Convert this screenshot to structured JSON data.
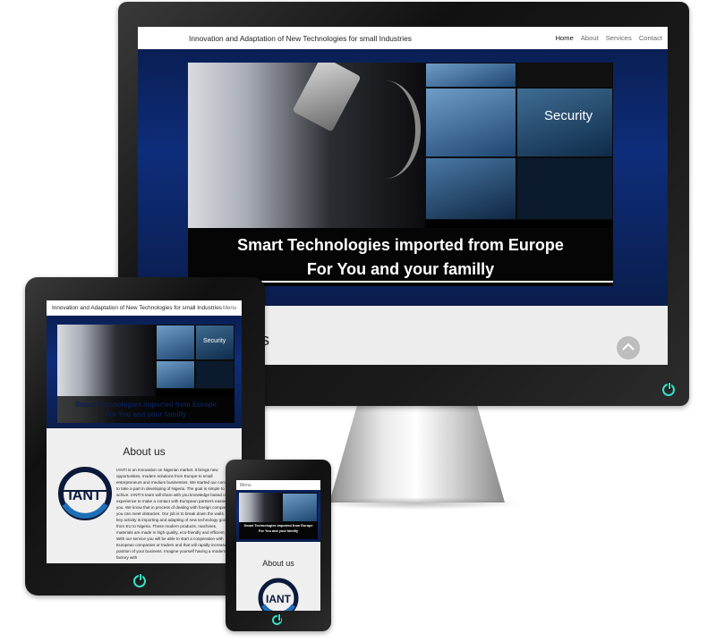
{
  "site": {
    "title": "Innovation and Adaptation of New Technologies for small Industries",
    "nav": [
      "Home",
      "About",
      "Services",
      "Contact"
    ],
    "menu_label": "Menu",
    "hero_line1": "Smart Technologies imported from Europe",
    "hero_line2": "For You and your familly",
    "security_label": "Security",
    "about_heading": "About us",
    "about_partial": "s",
    "logo_text": "IANT",
    "about_body": "IANTI is an innovation on Nigerian market. It brings new opportunities, modern solutions from Europe to small entrepreneurs and medium businesses. We started our company to take a part in developing of Nigeria. The goal is simple to achive. IANTI's team will share with you knowledge based on experience to make a contact with European partners easier for you. We know that in process of dealing with foreign companies you can meet obstacles. Our job is to break down the walls. Our key activity is importing and adapting of new technology goods from EU to Nigeria. These modern products, machines, materials are made in high quality, eco-friendly and efficient. With our service you will be able to start a cooperation with European companies or traders and that will rapidly increase position of your business. Imagine yourself having a modern factory with"
  },
  "colors": {
    "accent": "#35e2c4",
    "hero_blue": "#0e2d7a",
    "logo_blue": "#1e6fb8"
  },
  "icons": {
    "scroll_top": "chevron-up-icon",
    "power": "power-icon"
  }
}
